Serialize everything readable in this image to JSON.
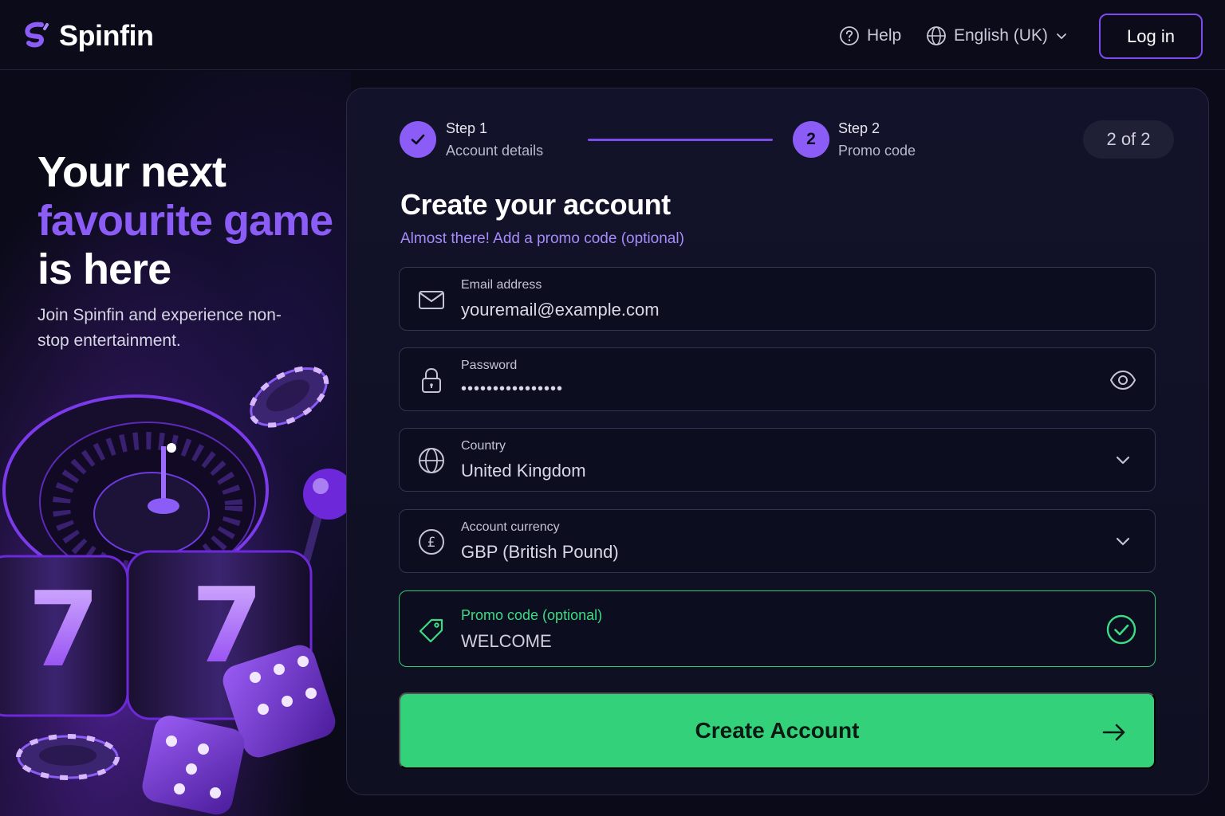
{
  "brand": {
    "name": "Spinfin"
  },
  "nav": {
    "help_label": "Help",
    "language_label": "English (UK)",
    "login_label": "Log in"
  },
  "hero": {
    "title_line1": "Your next",
    "title_line2": "favourite game",
    "title_line3": "is here",
    "subtitle": "Join Spinfin and experience non-stop entertainment."
  },
  "stepper": {
    "steps": [
      {
        "title": "Step 1",
        "description": "Account details",
        "state": "completed",
        "icon": "check-icon"
      },
      {
        "title": "Step 2",
        "description": "Promo code",
        "state": "active",
        "number": "2"
      }
    ],
    "progress_label": "2 of 2"
  },
  "form": {
    "title": "Create your account",
    "subtitle": "Almost there! Add a promo code (optional)",
    "fields": {
      "email": {
        "label": "Email address",
        "value": "youremail@example.com",
        "icon": "envelope-icon"
      },
      "password": {
        "label": "Password",
        "value": "••••••••••••••••",
        "icon": "lock-icon",
        "action_icon": "eye-icon"
      },
      "country": {
        "label": "Country",
        "value": "United Kingdom",
        "icon": "globe-icon",
        "action_icon": "chevron-down-icon"
      },
      "currency": {
        "label": "Account currency",
        "value": "GBP (British Pound)",
        "icon": "pound-icon",
        "action_icon": "chevron-down-icon"
      },
      "promo": {
        "label": "Promo code (optional)",
        "value": "WELCOME",
        "icon": "tag-icon",
        "status_icon": "check-circle-icon",
        "status": "valid"
      }
    },
    "submit_label": "Create Account"
  },
  "colors": {
    "accent": "#8b5cf6",
    "success": "#33d17a",
    "background": "#0a0a18",
    "card": "#12122a"
  }
}
